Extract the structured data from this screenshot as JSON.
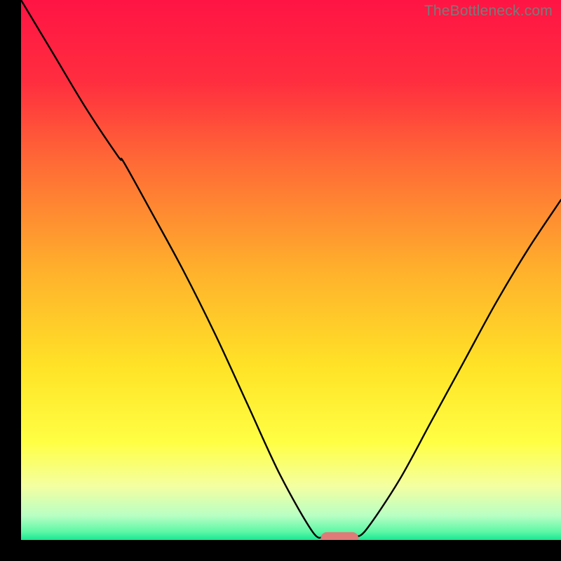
{
  "watermark": "TheBottleneck.com",
  "chart_data": {
    "type": "line",
    "title": "",
    "xlabel": "",
    "ylabel": "",
    "xlim": [
      0,
      100
    ],
    "ylim": [
      0,
      100
    ],
    "grid": false,
    "legend": false,
    "series": [
      {
        "name": "left-curve",
        "x": [
          0,
          6,
          12,
          18,
          19,
          24,
          30,
          36,
          42,
          48,
          54,
          56
        ],
        "y": [
          100,
          90,
          80,
          71,
          70,
          61,
          50,
          38,
          25,
          12,
          1.5,
          0.6
        ]
      },
      {
        "name": "right-curve",
        "x": [
          62,
          64,
          70,
          76,
          82,
          88,
          94,
          100
        ],
        "y": [
          0.6,
          2,
          11,
          22,
          33,
          44,
          54,
          63
        ]
      }
    ],
    "marker": {
      "name": "optimal-marker",
      "x_center": 59,
      "width": 7,
      "y": 0.3,
      "color": "#e07a78"
    },
    "background_gradient": {
      "type": "vertical",
      "stops": [
        {
          "offset": 0.0,
          "color": "#ff1444"
        },
        {
          "offset": 0.15,
          "color": "#ff2d3f"
        },
        {
          "offset": 0.3,
          "color": "#ff6a36"
        },
        {
          "offset": 0.5,
          "color": "#ffb02c"
        },
        {
          "offset": 0.68,
          "color": "#ffe327"
        },
        {
          "offset": 0.82,
          "color": "#ffff44"
        },
        {
          "offset": 0.9,
          "color": "#f4ffa0"
        },
        {
          "offset": 0.955,
          "color": "#b8ffc4"
        },
        {
          "offset": 0.985,
          "color": "#5cf7a6"
        },
        {
          "offset": 1.0,
          "color": "#18e892"
        }
      ]
    }
  }
}
